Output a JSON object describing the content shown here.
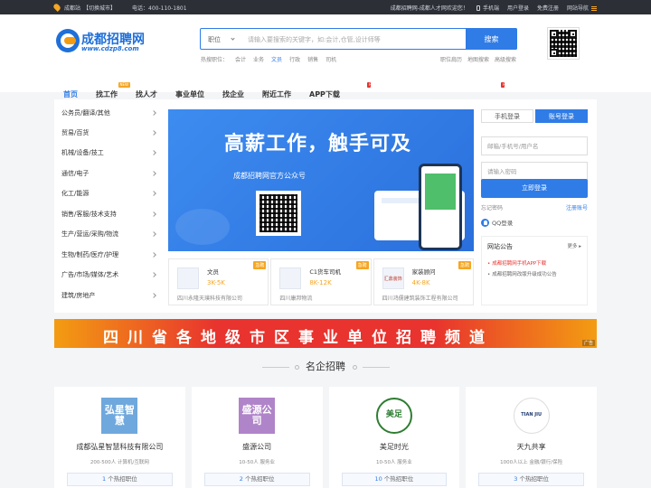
{
  "topbar": {
    "city": "成都站",
    "switch": "【切换城市】",
    "phone": "电话：400-110-1801",
    "welcome": "成都招聘网-成都人才网欢迎您！",
    "mobile": "手机端",
    "login": "用户登录",
    "register": "免费注册",
    "site_nav": "网站导航"
  },
  "logo": {
    "name": "成都招聘网",
    "url": "www.cdzp8.com"
  },
  "search": {
    "category": "职位",
    "placeholder": "请输入要搜索的关键字，如:会计,仓管,设计师等",
    "button": "搜索",
    "hot_label": "热搜职位：",
    "hot": [
      "会计",
      "业务",
      "文员",
      "行政",
      "销售",
      "司机"
    ],
    "links": [
      "职位肩历",
      "地图搜索",
      "高级搜索"
    ]
  },
  "nav": {
    "items": [
      "首页",
      "找工作",
      "找人才",
      "事业单位",
      "找企业",
      "附近工作",
      "APP下载"
    ],
    "tags": {
      "new": "NEW",
      "hot": "HOT"
    }
  },
  "categories": [
    "公务员/翻译/其他",
    "贸易/百货",
    "机械/设备/技工",
    "通信/电子",
    "化工/能源",
    "销售/客服/技术支持",
    "生产/营运/采购/物流",
    "生物/制药/医疗/护理",
    "广告/市场/媒体/艺术",
    "建筑/房地产"
  ],
  "banner": {
    "title": "高薪工作，触手可及",
    "subtitle": "成都招聘网官方公众号"
  },
  "featured_jobs": [
    {
      "title": "文员",
      "salary": "3K-5K",
      "company": "四川永隆天璞科技有限公司",
      "badge": "急聘",
      "thumb_label": ""
    },
    {
      "title": "C1货车司机",
      "salary": "8K-12K",
      "company": "四川康邦物流",
      "badge": "急聘",
      "thumb_label": ""
    },
    {
      "title": "家装顾问",
      "salary": "4K-8K",
      "company": "四川鸿儒建筑装饰工程有限公司",
      "badge": "急聘",
      "thumb_label": "汇鼎装饰"
    }
  ],
  "login": {
    "tab_mobile": "手机登录",
    "tab_account": "账号登录",
    "user_placeholder": "邮箱/手机号/用户名",
    "pass_placeholder": "请输入密码",
    "submit": "立即登录",
    "forgot": "忘记密码",
    "register": "注册账号",
    "qq": "QQ登录"
  },
  "notice": {
    "title": "网站公告",
    "more": "更多",
    "items": [
      "成都招聘网手机APP下载",
      "成都招聘网改版升级成功公告"
    ]
  },
  "ad": {
    "text": "四川省各地级市区事业单位招聘频道",
    "tag": "广告"
  },
  "companies_section": {
    "title": "名企招聘"
  },
  "companies": [
    {
      "logo_text": "弘星智慧",
      "logo_color": "#6fa8dc",
      "name": "成都弘星智慧科技有限公司",
      "meta": "200-500人  计算机/互联网",
      "jobs_count": "1",
      "jobs_label": "个热招职位"
    },
    {
      "logo_text": "盛源公司",
      "logo_color": "#b084c9",
      "name": "盛源公司",
      "meta": "10-50人  服务业",
      "jobs_count": "2",
      "jobs_label": "个热招职位"
    },
    {
      "logo_text": "美足",
      "logo_color": "#2e7d32",
      "name": "美足时光",
      "meta": "10-50人  服务业",
      "jobs_count": "10",
      "jobs_label": "个热招职位"
    },
    {
      "logo_text": "TIAN JIU",
      "logo_color": "#1f3b70",
      "name": "天九共享",
      "meta": "1000人以上  金融/银行/保险",
      "jobs_count": "3",
      "jobs_label": "个热招职位"
    }
  ]
}
